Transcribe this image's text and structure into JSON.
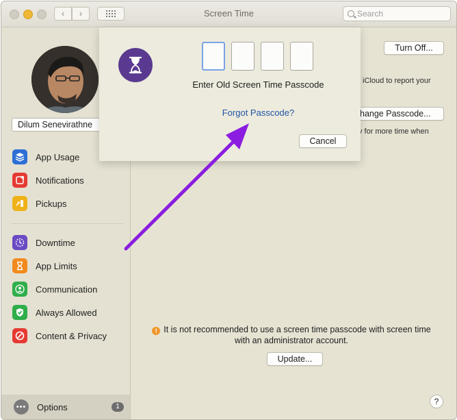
{
  "window": {
    "title": "Screen Time",
    "search_placeholder": "Search",
    "nav_back": "‹",
    "nav_forward": "›"
  },
  "sidebar": {
    "user_name": "Dilum Senevirathne",
    "items": [
      {
        "label": "App Usage",
        "icon": "app-usage-icon",
        "color": "#2e6fd6"
      },
      {
        "label": "Notifications",
        "icon": "notifications-icon",
        "color": "#e53a32"
      },
      {
        "label": "Pickups",
        "icon": "pickups-icon",
        "color": "#efb219"
      },
      {
        "label": "Downtime",
        "icon": "downtime-icon",
        "color": "#6b4bc4"
      },
      {
        "label": "App Limits",
        "icon": "app-limits-icon",
        "color": "#f08a1d"
      },
      {
        "label": "Communication",
        "icon": "communication-icon",
        "color": "#2fae4a"
      },
      {
        "label": "Always Allowed",
        "icon": "always-allowed-icon",
        "color": "#2fae4a"
      },
      {
        "label": "Content & Privacy",
        "icon": "content-privacy-icon",
        "color": "#e53a32"
      }
    ],
    "options": {
      "label": "Options",
      "badge": "1"
    }
  },
  "main": {
    "turn_off_label": "Turn Off...",
    "change_passcode_label": "hange Passcode...",
    "icloud_text": "iCloud to report your",
    "more_time_text": "v for more time when",
    "warning_text": "It is not recommended to use a screen time passcode with screen time with an administrator account.",
    "update_label": "Update...",
    "help_label": "?"
  },
  "sheet": {
    "title": "Enter Old Screen Time Passcode",
    "forgot_label": "Forgot Passcode?",
    "cancel_label": "Cancel",
    "passcode_digits": [
      "",
      "",
      "",
      ""
    ]
  },
  "colors": {
    "annotation_arrow": "#8a1de0",
    "link": "#2454a6",
    "sheet_icon": "#5a3a91"
  }
}
